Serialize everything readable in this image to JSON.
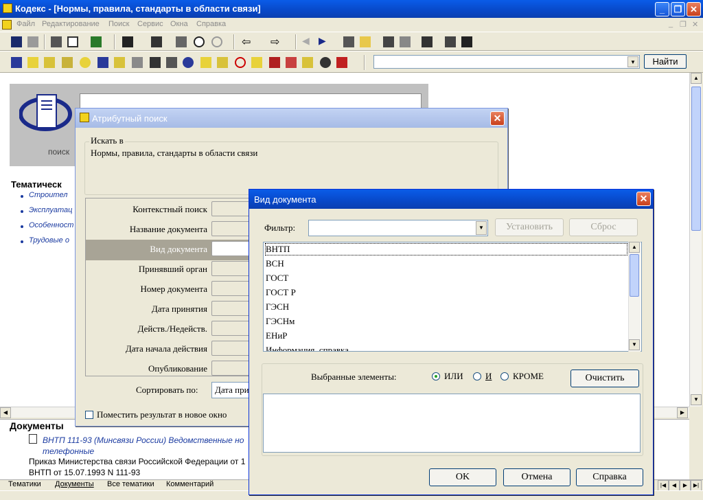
{
  "window": {
    "title": "Кодекс - [Нормы, правила, стандарты в области связи]"
  },
  "menu": [
    "Файл",
    "Редактирование",
    "Поиск",
    "Сервис",
    "Окна",
    "Справка"
  ],
  "toolbar": {
    "find_label": "Найти"
  },
  "hero": {
    "label": "поиск"
  },
  "thematic": {
    "title": "Тематическ",
    "items": [
      "Строител",
      "Эксплуатац",
      "Особенност",
      "Трудовые о"
    ]
  },
  "documents": {
    "title": "Документы",
    "link_line1": "ВНТП 111-93 (Минсвязи России) Ведомственные но",
    "link_line2": "телефонные",
    "line1": "Приказ Министерства связи Российской Федерации от 1",
    "line2": "ВНТП от 15.07.1993 N 111-93"
  },
  "tabs": [
    "Тематики",
    "Документы",
    "Все тематики",
    "Комментарий"
  ],
  "attr_dialog": {
    "title": "Атрибутный поиск",
    "group_label": "Искать в",
    "group_text": "Нормы, правила, стандарты в области связи",
    "fields": [
      "Контекстный поиск",
      "Название документа",
      "Вид документа",
      "Принявший орган",
      "Номер документа",
      "Дата принятия",
      "Действ./Недейств.",
      "Дата начала действия",
      "Опубликование"
    ],
    "sort_label": "Сортировать по:",
    "sort_value": "Дата при",
    "checkbox_label": "Поместить результат в новое окно"
  },
  "doctype_dialog": {
    "title": "Вид документа",
    "filter_label": "Фильтр:",
    "filter_value": "",
    "set_button": "Установить",
    "reset_button": "Сброс",
    "items": [
      "ВНТП",
      "ВСН",
      "ГОСТ",
      "ГОСТ Р",
      "ГЭСН",
      "ГЭСНм",
      "ЕНиР",
      "Информация, справка"
    ],
    "selected_label": "Выбранные элементы:",
    "radios": [
      {
        "label": "ИЛИ",
        "checked": true
      },
      {
        "label": "И",
        "checked": false
      },
      {
        "label": "КРОМЕ",
        "checked": false
      }
    ],
    "clear_button": "Очистить",
    "ok_button": "OK",
    "cancel_button": "Отмена",
    "help_button": "Справка"
  }
}
